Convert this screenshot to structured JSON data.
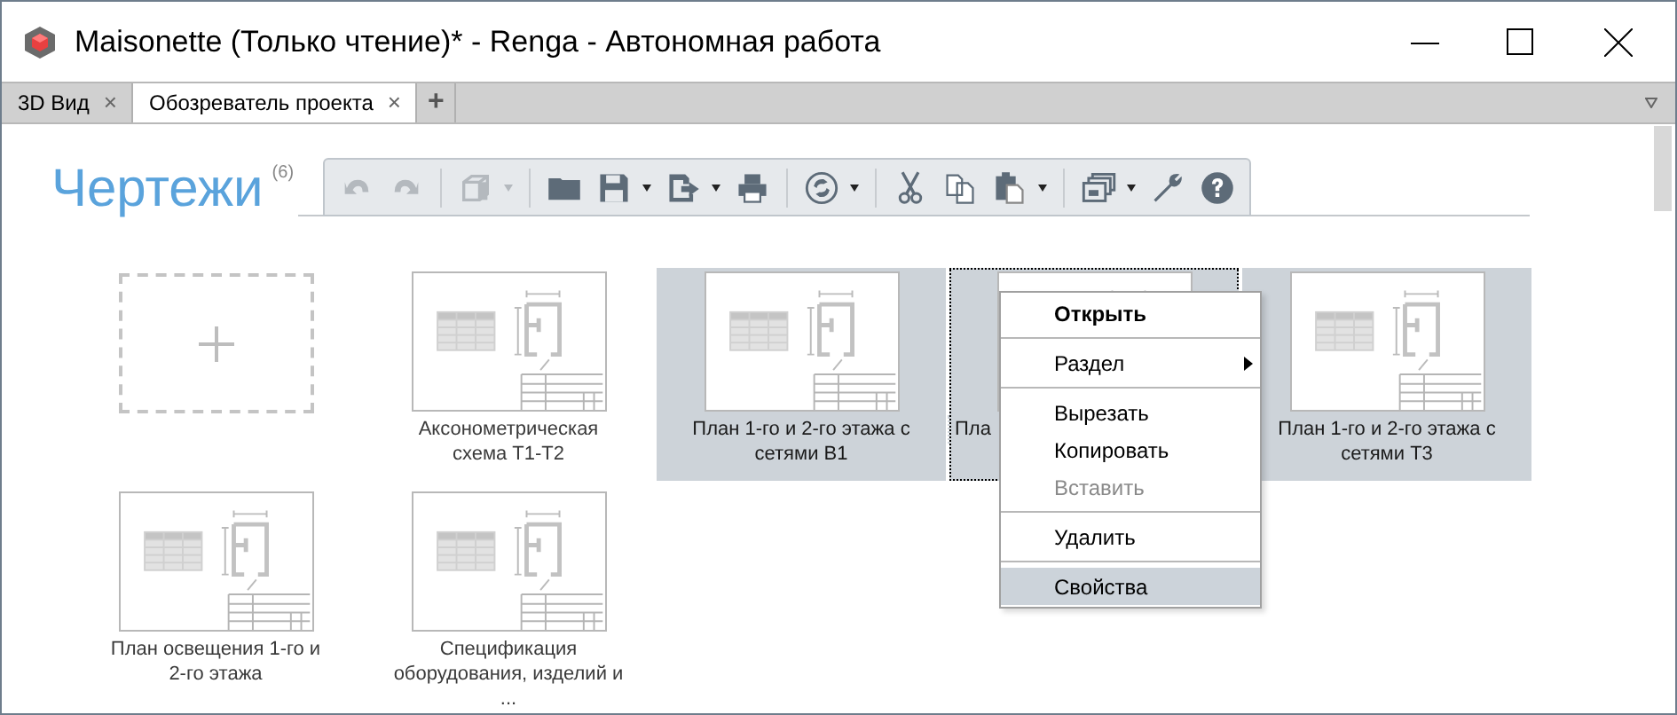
{
  "window": {
    "title": "Maisonette (Только чтение)* - Renga - Автономная работа"
  },
  "tabs": [
    {
      "label": "3D Вид",
      "selected": false,
      "close": "×"
    },
    {
      "label": "Обозреватель проекта",
      "selected": true,
      "close": "×"
    }
  ],
  "new_tab": "+",
  "heading": {
    "title": "Чертежи",
    "count": "(6)"
  },
  "toolbar": [
    [
      {
        "disabled": true,
        "dropdown": false
      },
      {
        "disabled": true,
        "dropdown": false
      }
    ],
    [
      {
        "disabled": true,
        "dropdown": true
      }
    ],
    [
      {
        "disabled": false,
        "dropdown": false
      },
      {
        "disabled": false,
        "dropdown": true
      },
      {
        "disabled": false,
        "dropdown": true
      },
      {
        "disabled": false,
        "dropdown": false
      }
    ],
    [
      {
        "disabled": false,
        "dropdown": true
      }
    ],
    [
      {
        "disabled": false,
        "dropdown": false
      },
      {
        "disabled": false,
        "dropdown": false
      },
      {
        "disabled": false,
        "dropdown": true
      }
    ],
    [
      {
        "disabled": false,
        "dropdown": true
      },
      {
        "disabled": false,
        "dropdown": false
      },
      {
        "disabled": false,
        "dropdown": false
      }
    ]
  ],
  "tiles": [
    {
      "kind": "add",
      "selected": false,
      "focused": false
    },
    {
      "kind": "drawing",
      "label": "Аксонометрическая схема Т1-Т2",
      "selected": false,
      "focused": false,
      "obscured": false
    },
    {
      "kind": "drawing",
      "label": "План 1-го и 2-го этажа с сетями В1",
      "selected": true,
      "focused": false,
      "obscured": false
    },
    {
      "kind": "drawing",
      "label": "Пла",
      "selected": true,
      "focused": true,
      "obscured": true
    },
    {
      "kind": "drawing",
      "label": "План 1-го и 2-го этажа с сетями Т3",
      "selected": true,
      "focused": false,
      "obscured": false
    },
    {
      "kind": "drawing",
      "label": "План освещения 1-го и 2-го этажа",
      "selected": false,
      "focused": false,
      "obscured": false
    },
    {
      "kind": "drawing",
      "label": "Спецификация оборудования, изделий и ...",
      "selected": false,
      "focused": false,
      "obscured": false
    }
  ],
  "context_menu": [
    [
      {
        "kind": "default",
        "label": "Открыть",
        "disabled": false,
        "selected": false
      }
    ],
    [
      {
        "kind": "submenu",
        "label": "Раздел",
        "disabled": false,
        "selected": false
      }
    ],
    [
      {
        "kind": "item",
        "label": "Вырезать",
        "disabled": false,
        "selected": false
      },
      {
        "kind": "item",
        "label": "Копировать",
        "disabled": false,
        "selected": false
      },
      {
        "kind": "item",
        "label": "Вставить",
        "disabled": true,
        "selected": false
      }
    ],
    [
      {
        "kind": "item",
        "label": "Удалить",
        "disabled": false,
        "selected": false
      }
    ],
    [
      {
        "kind": "item",
        "label": "Свойства",
        "disabled": false,
        "selected": true
      }
    ]
  ]
}
